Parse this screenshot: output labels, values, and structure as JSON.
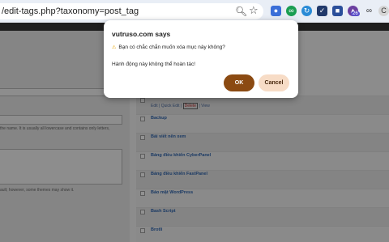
{
  "browser": {
    "url": "/edit-tags.php?taxonomy=post_tag",
    "badge": "26",
    "profile_label": "C"
  },
  "form": {
    "name_help": "the name. It is usually all lowercase and contains only letters,",
    "desc_help": "ault; however, some themes may show it."
  },
  "row_actions": {
    "edit": "Edit",
    "quick_edit": "Quick Edit",
    "delete": "Delete",
    "view": "View",
    "sep": "|"
  },
  "tags": [
    {
      "name": "Backup"
    },
    {
      "name": "Bài viết nên xem"
    },
    {
      "name": "Bảng điều khiển CyberPanel"
    },
    {
      "name": "Bảng điều khiển FastPanel"
    },
    {
      "name": "Bảo mật WordPress"
    },
    {
      "name": "Bash Script"
    },
    {
      "name": "Brotli"
    }
  ],
  "dialog": {
    "title": "vutruso.com says",
    "warning": "Bạn có chắc chắn muốn xóa mục này không?",
    "note": "Hành động này không thể hoàn tác!",
    "ok_label": "OK",
    "cancel_label": "Cancel"
  },
  "colors": {
    "ok_button": "#8b4a12",
    "cancel_button": "#f7dcc6"
  }
}
